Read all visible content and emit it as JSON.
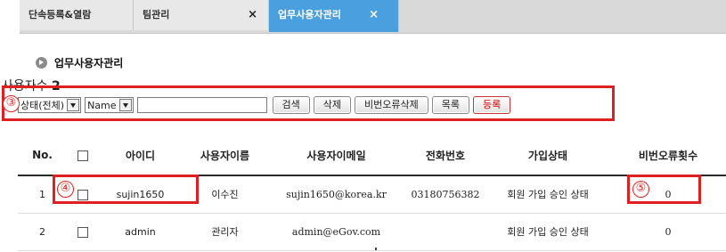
{
  "tabs": [
    {
      "label": "단속등록&열람",
      "closable": false
    },
    {
      "label": "팀관리",
      "closable": true
    },
    {
      "label": "업무사용자관리",
      "closable": true,
      "active": true
    }
  ],
  "close_glyph": "×",
  "heading": "업무사용자관리",
  "user_count_label": "사용자수",
  "user_count": "2",
  "filters": {
    "status_select": "상태(전체)",
    "field_select": "Name",
    "search_value": ""
  },
  "buttons": {
    "search": "검색",
    "delete": "삭제",
    "reset_pw_errors": "비번오류삭제",
    "list": "목록",
    "register": "등록"
  },
  "annotations": [
    "③",
    "④",
    "⑤"
  ],
  "table": {
    "columns": [
      "No.",
      "",
      "아이디",
      "사용자이름",
      "사용자이메일",
      "전화번호",
      "가입상태",
      "비번오류횟수"
    ],
    "rows": [
      {
        "no": "1",
        "id": "sujin1650",
        "name": "이수진",
        "email": "sujin1650@korea.kr",
        "phone": "03180756382",
        "status": "회원 가입 승인 상태",
        "pw_errors": "0"
      },
      {
        "no": "2",
        "id": "admin",
        "name": "관리자",
        "email": "admin@eGov.com",
        "phone": "",
        "status": "회원 가입 승인 상태",
        "pw_errors": "0"
      }
    ]
  },
  "colors": {
    "active_tab": "#4aa0de",
    "highlight": "#e02020",
    "register_text": "#cc0000"
  }
}
